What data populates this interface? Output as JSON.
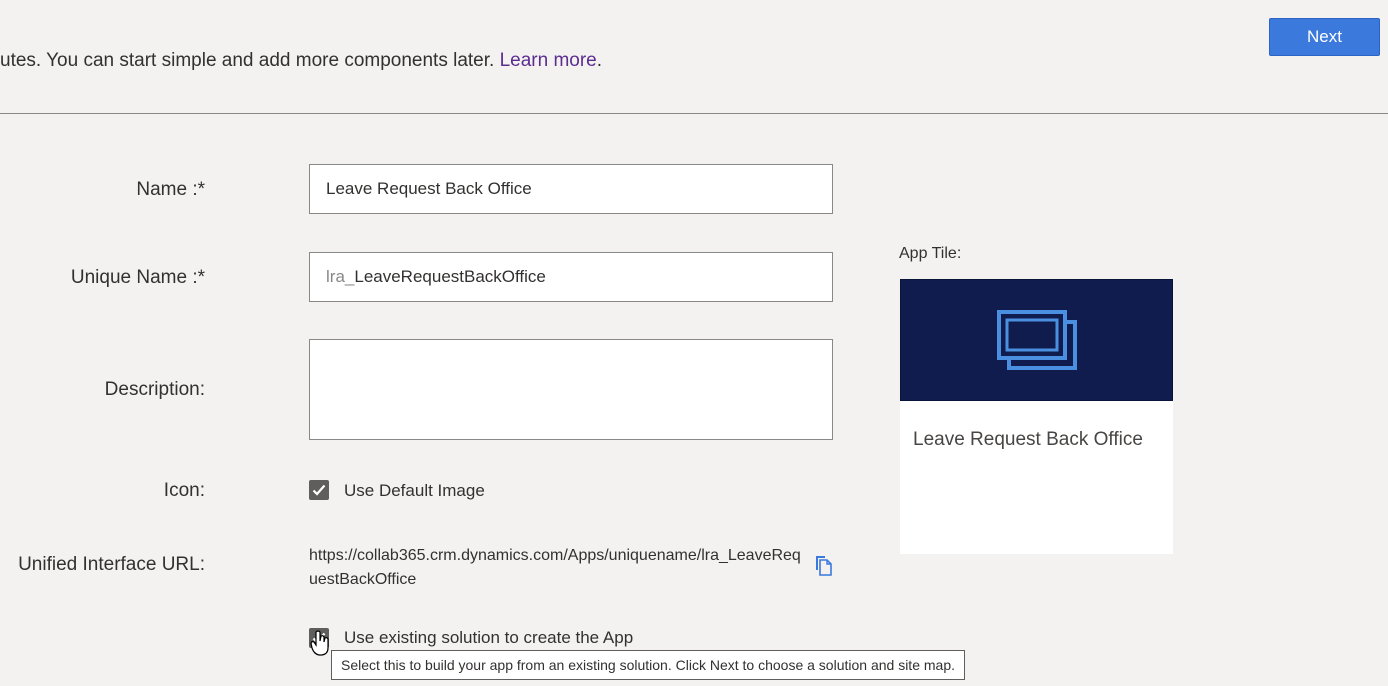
{
  "header": {
    "intro_text": "utes. You can start simple and add more components later.",
    "learn_more": "Learn more",
    "period": ".",
    "next_label": "Next"
  },
  "form": {
    "name": {
      "label": "Name :*",
      "value": "Leave Request Back Office"
    },
    "unique_name": {
      "label": "Unique Name :*",
      "prefix": "lra_",
      "value": "LeaveRequestBackOffice"
    },
    "description": {
      "label": "Description:",
      "value": ""
    },
    "icon": {
      "label": "Icon:",
      "checkbox_label": "Use Default Image",
      "checked": true
    },
    "url": {
      "label": "Unified Interface URL:",
      "value": "https://collab365.crm.dynamics.com/Apps/uniquename/lra_LeaveRequestBackOffice",
      "icon": "copy-icon"
    },
    "existing_solution": {
      "checkbox_label": "Use existing solution to create the App",
      "checked": true
    }
  },
  "app_tile": {
    "label": "App Tile:",
    "name": "Leave Request Back Office",
    "background_color": "#0f1c4d",
    "icon_color": "#4a8fe0",
    "icon": "app-stack-icon"
  },
  "tooltip": {
    "text": "Select this to build your app from an existing solution. Click Next to choose a solution and site map."
  },
  "colors": {
    "accent": "#3b79dd",
    "link": "#5c2d91",
    "page_bg": "#f3f2f1"
  }
}
